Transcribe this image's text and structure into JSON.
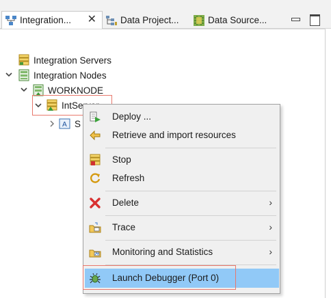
{
  "tabs": [
    {
      "label": "Integration...",
      "icon": "integration-explorer-icon",
      "active": true,
      "closable": true
    },
    {
      "label": "Data Project...",
      "icon": "data-project-icon",
      "active": false
    },
    {
      "label": "Data Source...",
      "icon": "data-source-icon",
      "active": false
    }
  ],
  "view_buttons": {
    "minimize": "minimize-icon",
    "maximize": "maximize-icon"
  },
  "tree": {
    "integration_servers": "Integration Servers",
    "integration_nodes": "Integration Nodes",
    "worknode": "WORKNODE",
    "intserver": "IntServer",
    "child_partial": "S"
  },
  "menu": {
    "items": [
      {
        "label": "Deploy ...",
        "icon": "deploy-icon",
        "submenu": false
      },
      {
        "label": "Retrieve and import resources",
        "icon": "retrieve-icon",
        "submenu": false
      },
      {
        "label": "Stop",
        "icon": "stop-server-icon",
        "submenu": false
      },
      {
        "label": "Refresh",
        "icon": "refresh-icon",
        "submenu": false
      },
      {
        "label": "Delete",
        "icon": "delete-icon",
        "submenu": true
      },
      {
        "label": "Trace",
        "icon": "trace-icon",
        "submenu": true
      },
      {
        "label": "Monitoring and Statistics",
        "icon": "monitoring-icon",
        "submenu": true
      },
      {
        "label": "Launch Debugger (Port 0)",
        "icon": "debugger-icon",
        "submenu": false,
        "selected": true
      }
    ],
    "submenu_arrow": "›"
  },
  "colors": {
    "selection": "#91c9f7",
    "highlight_box": "#e8786c",
    "menu_bg": "#f0f0f0"
  }
}
